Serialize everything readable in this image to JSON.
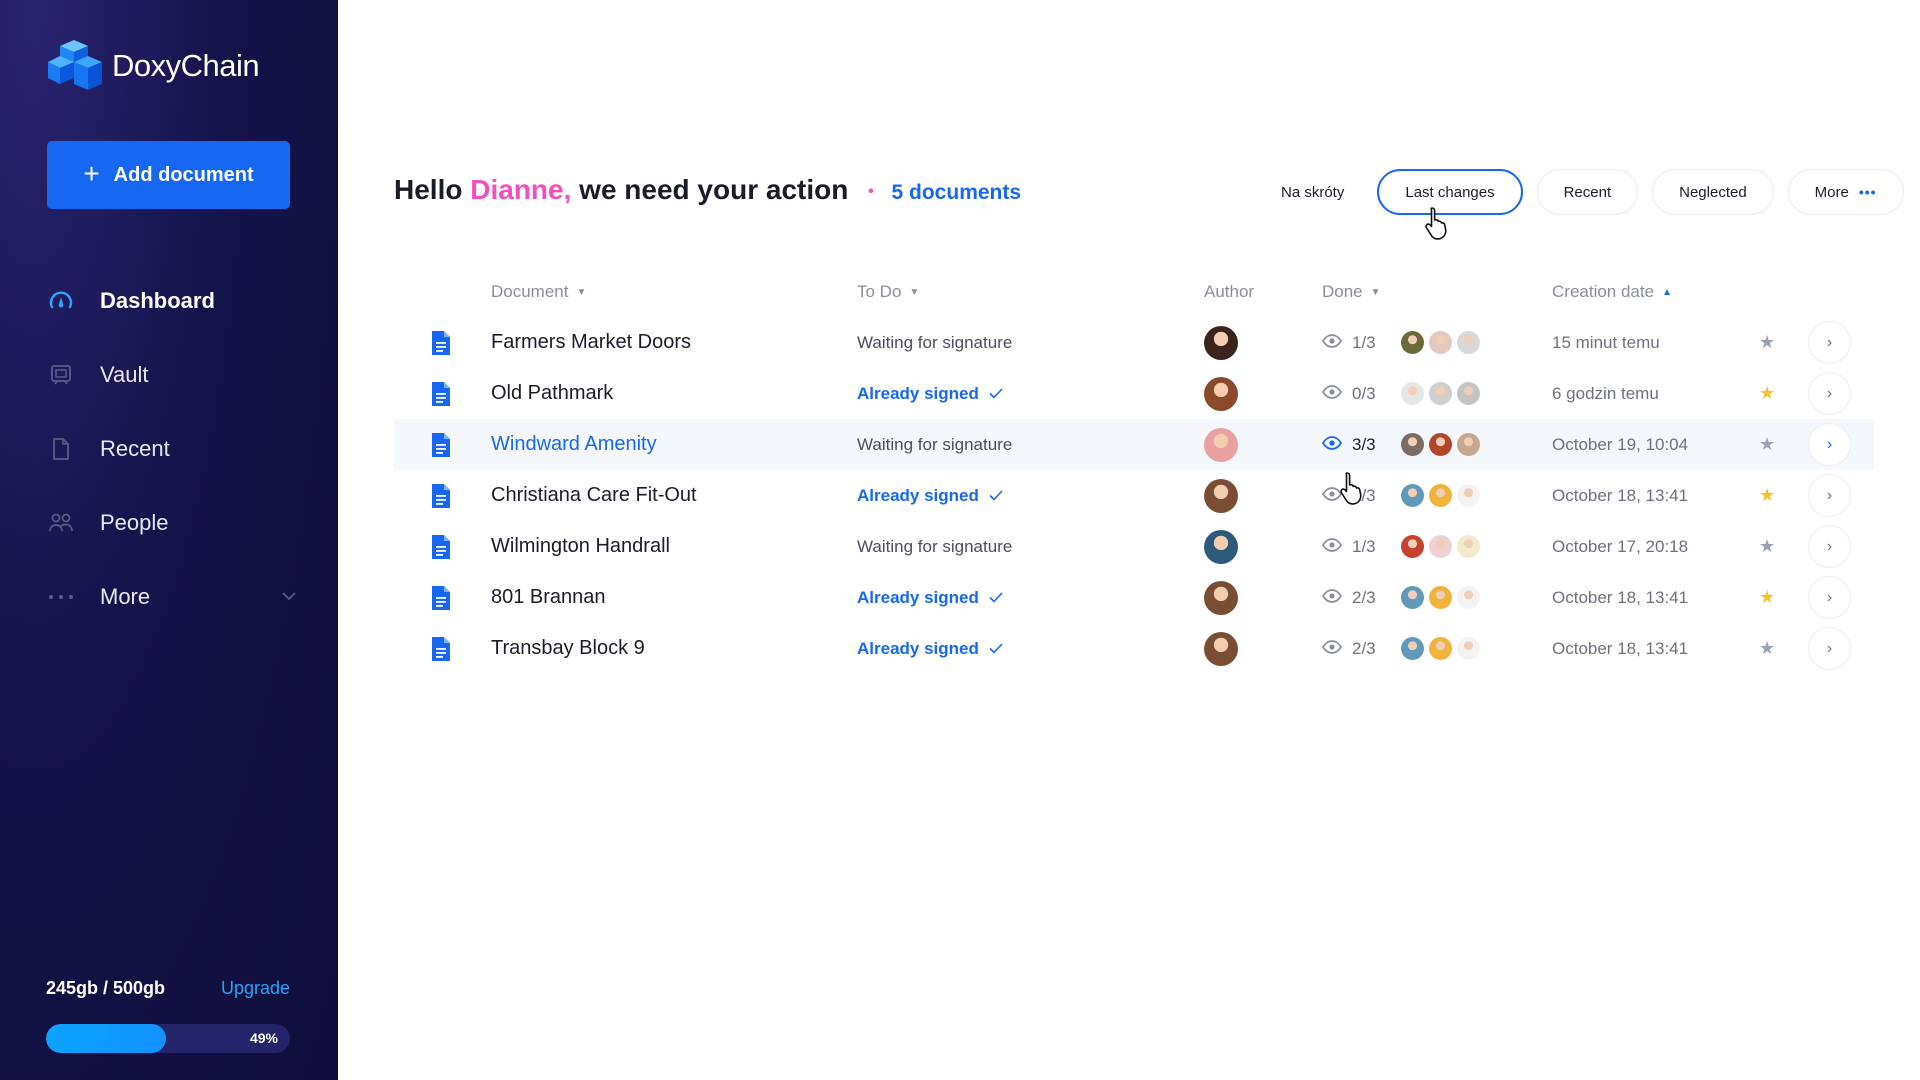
{
  "app": {
    "name": "DoxyChain"
  },
  "sidebar": {
    "add_button": "Add document",
    "nav": [
      {
        "label": "Dashboard",
        "icon": "gauge-icon",
        "active": true
      },
      {
        "label": "Vault",
        "icon": "vault-icon",
        "active": false
      },
      {
        "label": "Recent",
        "icon": "file-icon",
        "active": false
      },
      {
        "label": "People",
        "icon": "people-icon",
        "active": false
      },
      {
        "label": "More",
        "icon": "dots-icon",
        "active": false
      }
    ],
    "storage": {
      "used": "245gb / 500gb",
      "upgrade": "Upgrade",
      "percent": 49,
      "percent_label": "49%"
    }
  },
  "header": {
    "hello": "Hello",
    "name": "Dianne,",
    "message": "we need your action",
    "dot": "•",
    "docs_count": "5 documents"
  },
  "filters": [
    {
      "label": "Na skróty",
      "style": "plain"
    },
    {
      "label": "Last changes",
      "style": "active"
    },
    {
      "label": "Recent",
      "style": "normal"
    },
    {
      "label": "Neglected",
      "style": "normal"
    },
    {
      "label": "More",
      "style": "more"
    }
  ],
  "table": {
    "columns": {
      "document": "Document",
      "todo": "To Do",
      "author": "Author",
      "done": "Done",
      "creation_date": "Creation date"
    },
    "rows": [
      {
        "name": "Farmers Market Doors",
        "todo": "Waiting for signature",
        "signed": false,
        "done": "1/3",
        "date": "15 minut temu",
        "starred": false,
        "highlight": false
      },
      {
        "name": "Old Pathmark",
        "todo": "Already signed",
        "signed": true,
        "done": "0/3",
        "date": "6 godzin temu",
        "starred": true,
        "highlight": false
      },
      {
        "name": "Windward Amenity",
        "todo": "Waiting for signature",
        "signed": false,
        "done": "3/3",
        "date": "October 19, 10:04",
        "starred": false,
        "highlight": true
      },
      {
        "name": "Christiana Care Fit-Out",
        "todo": "Already signed",
        "signed": true,
        "done": "2/3",
        "date": "October 18, 13:41",
        "starred": true,
        "highlight": false
      },
      {
        "name": "Wilmington Handrall",
        "todo": "Waiting for signature",
        "signed": false,
        "done": "1/3",
        "date": "October 17, 20:18",
        "starred": false,
        "highlight": false
      },
      {
        "name": "801 Brannan",
        "todo": "Already signed",
        "signed": true,
        "done": "2/3",
        "date": "October 18, 13:41",
        "starred": true,
        "highlight": false
      },
      {
        "name": "Transbay Block 9",
        "todo": "Already signed",
        "signed": true,
        "done": "2/3",
        "date": "October 18, 13:41",
        "starred": false,
        "highlight": false
      }
    ]
  },
  "colors": {
    "accent": "#1668f2",
    "pink": "#f04fbd",
    "star": "#f5c32c",
    "sidebar_bg": "#14134a"
  },
  "avatars": {
    "author": [
      "#3b2419",
      "#8a4a2b",
      "#e9a0a0",
      "#7a4e32",
      "#2d5a78",
      "#7a4e32",
      "#7a4e32"
    ],
    "signers": [
      [
        "#6b6a3a",
        "#e3c9bf",
        "#d8d8d8"
      ],
      [
        "#e6e6e6",
        "#cfcfcf",
        "#c4c4c4"
      ],
      [
        "#7a6d66",
        "#b4452a",
        "#c9a78e"
      ],
      [
        "#5f9ab8",
        "#f1b43a",
        "#f3f3f3"
      ],
      [
        "#c8412f",
        "#f0d1d1",
        "#f4e9c8"
      ],
      [
        "#5f9ab8",
        "#f1b43a",
        "#f3f3f3"
      ],
      [
        "#5f9ab8",
        "#f1b43a",
        "#f3f3f3"
      ]
    ]
  }
}
